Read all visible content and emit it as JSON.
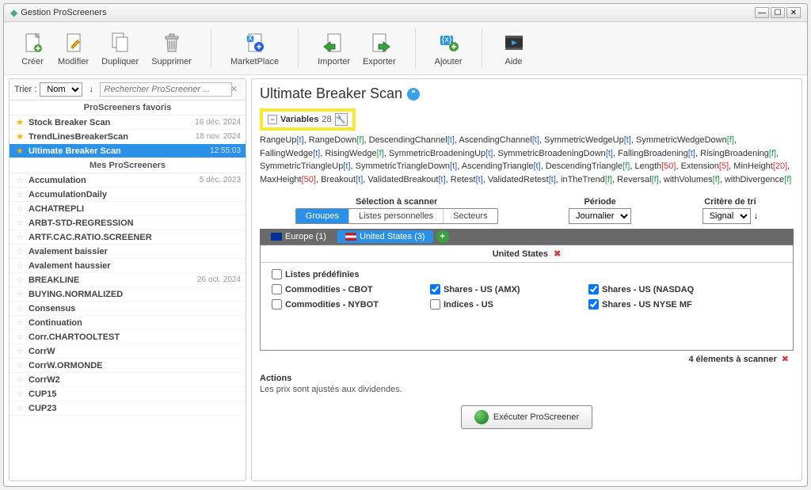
{
  "window": {
    "title": "Gestion ProScreeners"
  },
  "toolbar": {
    "create": "Créer",
    "modify": "Modifier",
    "duplicate": "Dupliquer",
    "delete": "Supprimer",
    "marketplace": "MarketPlace",
    "import": "Importer",
    "export": "Exporter",
    "add": "Ajouter",
    "help": "Aide"
  },
  "sort": {
    "label": "Trier :",
    "value": "Nom",
    "search_placeholder": "Rechercher ProScreener ..."
  },
  "sections": {
    "favorites": "ProScreeners favoris",
    "mine": "Mes ProScreeners"
  },
  "favorites": [
    {
      "name": "Stock Breaker Scan",
      "date": "16 déc. 2024",
      "starred": true
    },
    {
      "name": "TrendLinesBreakerScan",
      "date": "18 nov. 2024",
      "starred": true
    },
    {
      "name": "Ultimate Breaker Scan",
      "date": "12:55:03",
      "starred": true,
      "selected": true
    }
  ],
  "my_screeners": [
    {
      "name": "Accumulation",
      "date": "5 déc. 2023"
    },
    {
      "name": "AccumulationDaily",
      "date": ""
    },
    {
      "name": "ACHATREPLI",
      "date": ""
    },
    {
      "name": "ARBT-STD-REGRESSION",
      "date": ""
    },
    {
      "name": "ARTF.CAC.RATIO.SCREENER",
      "date": ""
    },
    {
      "name": "Avalement baissier",
      "date": ""
    },
    {
      "name": "Avalement haussier",
      "date": ""
    },
    {
      "name": "BREAKLINE",
      "date": "26 oct. 2024"
    },
    {
      "name": "BUYING.NORMALIZED",
      "date": ""
    },
    {
      "name": "Consensus",
      "date": ""
    },
    {
      "name": "Continuation",
      "date": ""
    },
    {
      "name": "Corr.CHARTOOLTEST",
      "date": ""
    },
    {
      "name": "CorrW",
      "date": ""
    },
    {
      "name": "CorrW.ORMONDE",
      "date": ""
    },
    {
      "name": "CorrW2",
      "date": ""
    },
    {
      "name": "CUP15",
      "date": ""
    },
    {
      "name": "CUP23",
      "date": ""
    }
  ],
  "detail": {
    "title": "Ultimate Breaker Scan",
    "variables_label": "Variables",
    "variables_count": "28",
    "variables": [
      {
        "name": "RangeUp",
        "v": "t"
      },
      {
        "name": "RangeDown",
        "v": "f"
      },
      {
        "name": "DescendingChannel",
        "v": "t"
      },
      {
        "name": "AscendingChannel",
        "v": "t"
      },
      {
        "name": "SymmetricWedgeUp",
        "v": "t"
      },
      {
        "name": "SymmetricWedgeDown",
        "v": "f"
      },
      {
        "name": "FallingWedge",
        "v": "t"
      },
      {
        "name": "RisingWedge",
        "v": "f"
      },
      {
        "name": "SymmetricBroadeningUp",
        "v": "t"
      },
      {
        "name": "SymmetricBroadeningDown",
        "v": "t"
      },
      {
        "name": "FallingBroadening",
        "v": "t"
      },
      {
        "name": "RisingBroadening",
        "v": "f"
      },
      {
        "name": "SymmetricTriangleUp",
        "v": "t"
      },
      {
        "name": "SymmetricTriangleDown",
        "v": "t"
      },
      {
        "name": "AscendingTriangle",
        "v": "t"
      },
      {
        "name": "DescendingTriangle",
        "v": "f"
      },
      {
        "name": "Length",
        "v": "50"
      },
      {
        "name": "Extension",
        "v": "5"
      },
      {
        "name": "MinHeight",
        "v": "20"
      },
      {
        "name": "MaxHeight",
        "v": "50"
      },
      {
        "name": "Breakout",
        "v": "t"
      },
      {
        "name": "ValidatedBreakout",
        "v": "t"
      },
      {
        "name": "Retest",
        "v": "t"
      },
      {
        "name": "ValidatedRetest",
        "v": "t"
      },
      {
        "name": "inTheTrend",
        "v": "f"
      },
      {
        "name": "Reversal",
        "v": "f"
      },
      {
        "name": "withVolumes",
        "v": "f"
      },
      {
        "name": "withDivergence",
        "v": "f"
      }
    ],
    "scan_selection_title": "Sélection à scanner",
    "groups": "Groupes",
    "personal_lists": "Listes personnelles",
    "sectors": "Secteurs",
    "period_title": "Période",
    "period_value": "Journalier",
    "sort_criterion_title": "Critère de tri",
    "sort_criterion_value": "Signal",
    "tab_europe": "Europe (1)",
    "tab_us": "United States (3)",
    "tab_header": "United States",
    "predefined_lists": "Listes prédéfinies",
    "checks": [
      {
        "label": "Commodities - CBOT",
        "checked": false
      },
      {
        "label": "Shares - US (AMX)",
        "checked": true
      },
      {
        "label": "Shares - US (NASDAQ",
        "checked": true
      },
      {
        "label": "Commodities - NYBOT",
        "checked": false
      },
      {
        "label": "Indices - US",
        "checked": false
      },
      {
        "label": "Shares - US NYSE MF",
        "checked": true
      }
    ],
    "footer_count": "4 élements à scanner",
    "actions_title": "Actions",
    "actions_note": "Les prix sont ajustés aux dividendes.",
    "execute": "Exécuter ProScreener"
  }
}
